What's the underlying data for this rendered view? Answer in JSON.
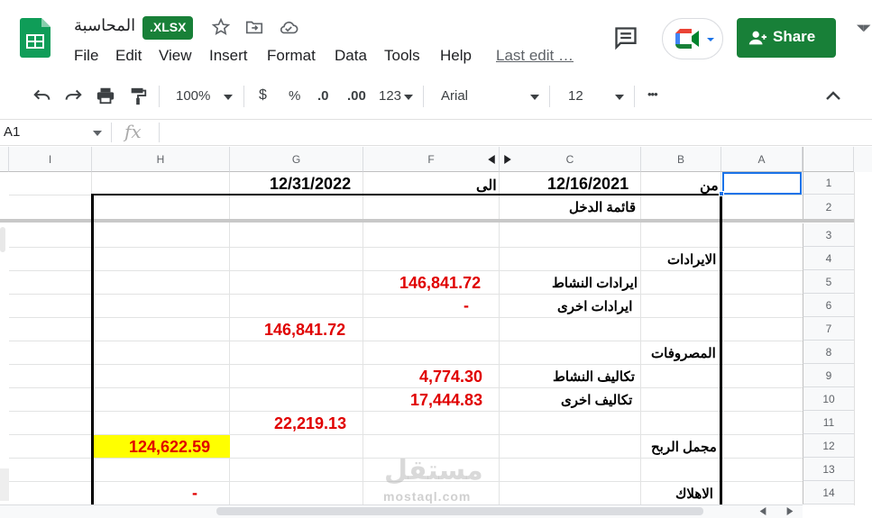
{
  "doc": {
    "title": "المحاسبة",
    "badge": ".XLSX",
    "last_edit": "Last edit …",
    "share_label": "Share"
  },
  "menu": [
    "File",
    "Edit",
    "View",
    "Insert",
    "Format",
    "Data",
    "Tools",
    "Help"
  ],
  "toolbar": {
    "zoom": "100%",
    "currency": "$",
    "percent": "%",
    "dec_less": ".0",
    "dec_more": ".00",
    "format_more": "123",
    "font": "Arial",
    "font_size": "12",
    "more": "•••"
  },
  "formula_bar": {
    "cell_ref": "A1",
    "fx": "fx"
  },
  "columns": [
    "I",
    "H",
    "G",
    "F",
    "C",
    "B",
    "A"
  ],
  "rows": [
    "1",
    "2",
    "3",
    "4",
    "5",
    "6",
    "7",
    "8",
    "9",
    "10",
    "11",
    "12",
    "13",
    "14"
  ],
  "sheet": {
    "r1_from": "من",
    "r1_from_date": "12/16/2021",
    "r1_to": "الى",
    "r1_to_date": "12/31/2022",
    "r2_title": "قائمة الدخل",
    "r4_revenues": "الايرادات",
    "r5_label": "ايرادات النشاط",
    "r5_value": "146,841.72",
    "r6_label": "ايرادات اخرى",
    "r6_value": "-",
    "r7_total": "146,841.72",
    "r8_expenses": "المصروفات",
    "r9_label": "تكاليف النشاط",
    "r9_value": "4,774.30",
    "r10_label": "تكاليف اخرى",
    "r10_value": "17,444.83",
    "r11_total": "22,219.13",
    "r12_label": "مجمل الربح",
    "r12_value": "124,622.59",
    "r14_label": "الاهلاك",
    "r14_value": "-"
  },
  "watermark": {
    "arabic": "مستقل",
    "latin": "mostaql.com"
  },
  "colors": {
    "brand_green": "#188038",
    "accent_red": "#e00000",
    "highlight": "#ffff00",
    "select_blue": "#1a73e8"
  }
}
